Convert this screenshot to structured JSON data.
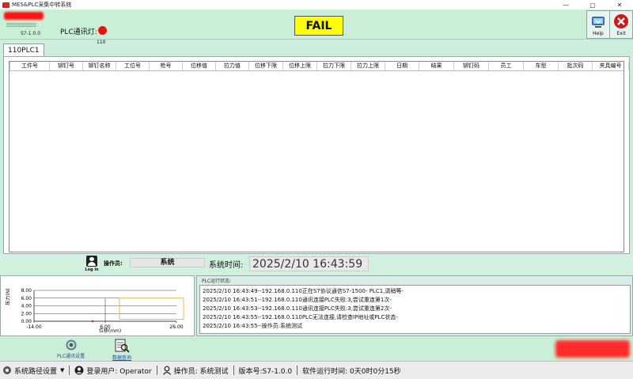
{
  "window": {
    "title": "MES&PLC采集中转系统",
    "controls": [
      "—",
      "▢",
      "✕"
    ]
  },
  "header": {
    "version": "S7-1.0.0",
    "plc_light_label": "PLC通讯灯:",
    "plc_light_code": "110",
    "plc_light_color": "#ee1111",
    "status_text": "FAIL",
    "status_color": "#ffff00",
    "help_label": "Help",
    "exit_label": "Exit"
  },
  "tabs": [
    {
      "label": "110PLC1"
    }
  ],
  "grid": {
    "columns": [
      "工件号",
      "铆钉号",
      "铆钉名称",
      "工位号",
      "枪号",
      "位移值",
      "拉力值",
      "位移下限",
      "位移上限",
      "拉力下限",
      "拉力上限",
      "日期",
      "结果",
      "铆钉码",
      "员工",
      "车型",
      "批次码",
      "夹具编号"
    ],
    "rows": []
  },
  "operator": {
    "login_label": "Log in",
    "operator_label": "操作员:",
    "operator_value": "系统",
    "time_label": "系统时间:",
    "time_value": "2025/2/10 16:43:59"
  },
  "chart_data": {
    "type": "line",
    "ylabel": "压力(N)",
    "xlabel": "位移(mm)",
    "y_ticks": [
      "8.00",
      "6.00",
      "4.00",
      "2.00",
      "0.00"
    ],
    "x_ticks": [
      "-14.00",
      "6.00",
      "26.00"
    ],
    "xlim": [
      -14,
      26
    ],
    "ylim": [
      0,
      8
    ],
    "reference_line_y": 6,
    "limit_box": {
      "x": [
        10,
        28
      ],
      "y": [
        0.5,
        6
      ]
    },
    "points": [
      {
        "x": 6,
        "y": 0
      }
    ]
  },
  "log": {
    "title": "PLC运行状态:",
    "lines": [
      "2025/2/10 16:43:49--192.168.0.110正在S7协议通信S7-1500- PLC1,请稍等-",
      "2025/2/10 16:43:51--192.168.0.110通讯连接PLC失败:3,尝试重连第1次-",
      "2025/2/10 16:43:53--192.168.0.110通讯连接PLC失败:3,尝试重连第2次-",
      "2025/2/10 16:43:55--192.168.0.110PLC无法连接,请检查IP地址或PLC状态-",
      "2025/2/10 16:43:55--操作员:系统测试"
    ]
  },
  "tools": {
    "plc_settings_label": "PLC通讯设置",
    "data_query_label": "数据查询"
  },
  "statusbar": {
    "path_settings": "系统路径设置",
    "login_user": "登录用户: Operator",
    "operator": "操作员: 系统测试",
    "version": "版本号:S7-1.0.0",
    "runtime": "软件运行时间: 0天0时0分15秒"
  }
}
